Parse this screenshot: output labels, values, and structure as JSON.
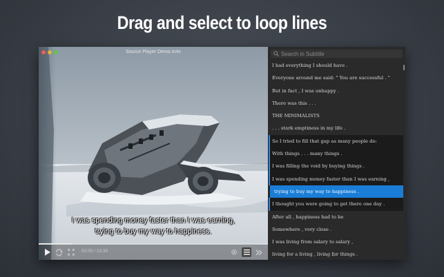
{
  "headline": "Drag and select to loop lines",
  "window": {
    "title": "Source Player Demo.m4v",
    "traffic_colors": [
      "#ec5f57",
      "#e1b33a",
      "#63c54c"
    ]
  },
  "player": {
    "subtitle_line1": "I was spending money faster than I was earning,",
    "subtitle_line2": "trying to buy my way to happiness.",
    "time": "02:00 / 13:33",
    "progress": 0.148
  },
  "sidebar": {
    "search_placeholder": "Search in Subtitle",
    "lines": [
      {
        "text": "I had everything I should have .",
        "state": "normal"
      },
      {
        "text": "Everyone around me said: \" You are successful . \"",
        "state": "normal"
      },
      {
        "text": "But in fact , I was unhappy .",
        "state": "normal"
      },
      {
        "text": "There was this . . .",
        "state": "normal"
      },
      {
        "text": "THE MINIMALISTS",
        "state": "normal"
      },
      {
        "text": ". . . stark emptiness in my life .",
        "state": "normal"
      },
      {
        "text": "So I tried to fill that gap as many people do:",
        "state": "loop"
      },
      {
        "text": "With things . . . many things .",
        "state": "loop"
      },
      {
        "text": "I was filling the void by buying things .",
        "state": "loop"
      },
      {
        "text": "I was spending money faster than I was earning ,",
        "state": "loop"
      },
      {
        "text": "trying to buy my way to happiness .",
        "state": "active"
      },
      {
        "text": "I thought you were going to get there one day .",
        "state": "loop"
      },
      {
        "text": "After all , happiness had to be",
        "state": "normal"
      },
      {
        "text": "Somewhere , very close .",
        "state": "normal"
      },
      {
        "text": "I was living from salary to salary ,",
        "state": "normal"
      },
      {
        "text": "living for a living , living for things .",
        "state": "normal"
      }
    ]
  },
  "colors": {
    "accent": "#1a7dd7",
    "loop_marker": "#3b82d6"
  }
}
